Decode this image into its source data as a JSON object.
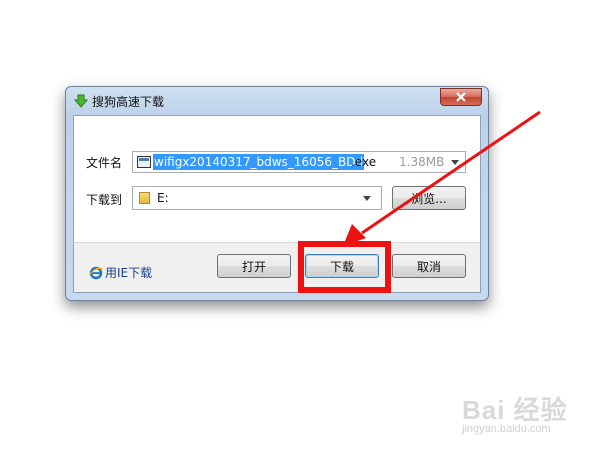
{
  "dialog": {
    "title": "搜狗高速下载",
    "close_icon": "close-x-icon",
    "filename_label": "文件名",
    "filename_selected": "wifigx20140317_bdws_16056_BDd",
    "filename_ext": ".exe",
    "file_size": "1.38MB",
    "download_to_label": "下载到",
    "download_dir": "E:",
    "browse_button": "浏览...",
    "ie_download_link": "用IE下载",
    "open_button": "打开",
    "download_button": "下载",
    "cancel_button": "取消"
  },
  "watermark": {
    "brand": "Bai 经验",
    "url": "jingyan.baidu.com"
  },
  "colors": {
    "annotation_red": "#ee1111",
    "selection_blue": "#3399ff",
    "title_bar": "#bcd2ea"
  }
}
